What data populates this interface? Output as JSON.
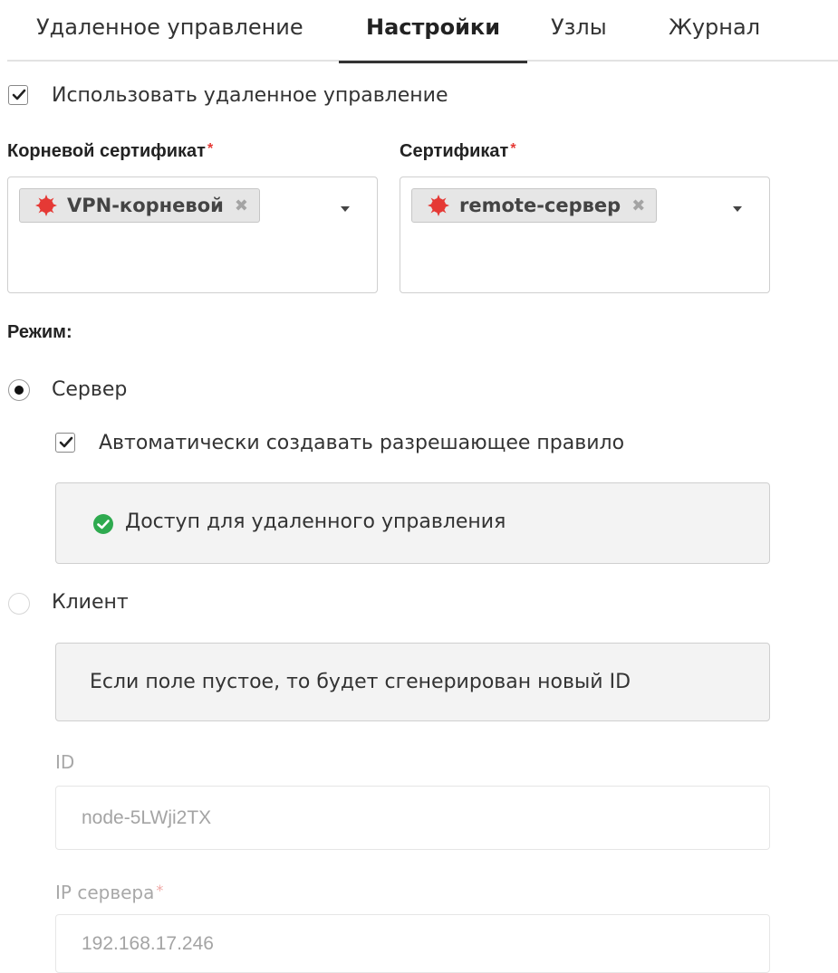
{
  "tabs": [
    {
      "label": "Удаленное управление",
      "active": false
    },
    {
      "label": "Настройки",
      "active": true
    },
    {
      "label": "Узлы",
      "active": false
    },
    {
      "label": "Журнал",
      "active": false
    }
  ],
  "use_remote": {
    "label": "Использовать удаленное управление",
    "checked": true
  },
  "root_cert": {
    "label": "Корневой сертификат",
    "required_mark": "*",
    "tag": "VPN-корневой"
  },
  "cert": {
    "label": "Сертификат",
    "required_mark": "*",
    "tag": "remote-сервер"
  },
  "mode": {
    "label": "Режим:",
    "server": {
      "label": "Сервер",
      "selected": true
    },
    "auto_rule": {
      "label": "Автоматически создавать разрешающее правило",
      "checked": true
    },
    "rule_box": "Доступ для удаленного управления",
    "client": {
      "label": "Клиент",
      "selected": false
    },
    "client_hint": "Если поле пустое, то будет сгенерирован новый ID"
  },
  "id_field": {
    "label": "ID",
    "value": "node-5LWji2TX"
  },
  "server_ip": {
    "label": "IP сервера",
    "required_mark": "*",
    "value": "192.168.17.246"
  },
  "colors": {
    "required": "#e53935",
    "tag_icon": "#e53935",
    "success": "#2eaa4f"
  },
  "icons": {
    "tag": "gear-icon",
    "remove": "close-icon",
    "success": "check-circle-icon"
  }
}
